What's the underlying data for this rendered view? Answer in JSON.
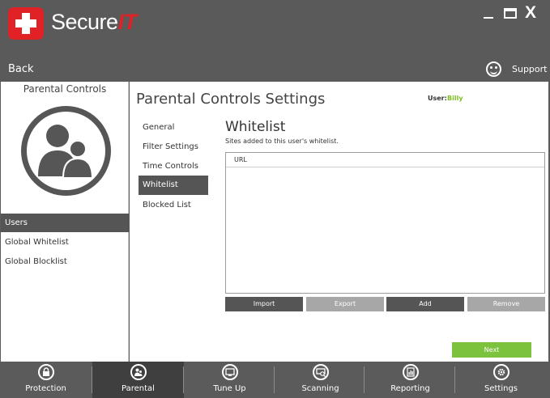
{
  "header": {
    "brand_main": "Secure",
    "brand_accent": "IT",
    "minimize": "",
    "close": "X",
    "back_label": "Back",
    "support_label": "Support"
  },
  "left": {
    "title": "Parental Controls",
    "items": [
      "Users",
      "Global Whitelist",
      "Global Blocklist"
    ],
    "active_index": 0
  },
  "main": {
    "title": "Parental Controls Settings",
    "user_label": "User:",
    "user_value": "Billy",
    "subnav": [
      "General",
      "Filter Settings",
      "Time Controls",
      "Whitelist",
      "Blocked List"
    ],
    "subnav_active": 3,
    "section_title": "Whitelist",
    "section_desc": "Sites added to this user's whitelist.",
    "table_header": "URL",
    "buttons": [
      "Import",
      "Export",
      "Add",
      "Remove"
    ],
    "next_label": "Next"
  },
  "nav": {
    "items": [
      {
        "label": "Protection",
        "icon": "lock-icon"
      },
      {
        "label": "Parental",
        "icon": "family-icon"
      },
      {
        "label": "Tune Up",
        "icon": "monitor-icon"
      },
      {
        "label": "Scanning",
        "icon": "scan-icon"
      },
      {
        "label": "Reporting",
        "icon": "report-icon"
      },
      {
        "label": "Settings",
        "icon": "gear-icon"
      }
    ],
    "active_index": 1
  },
  "colors": {
    "accent_green": "#7cbd22",
    "brand_red": "#e02126",
    "dark_gray": "#555555"
  }
}
